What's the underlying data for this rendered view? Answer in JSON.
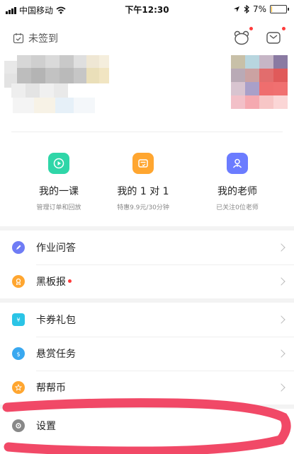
{
  "status_bar": {
    "carrier": "中国移动",
    "time": "下午12:30",
    "battery": "7%",
    "battery_level": 0.07
  },
  "header": {
    "checkin_label": "未签到",
    "icons": [
      "bear-icon",
      "mail-icon"
    ]
  },
  "quick_actions": [
    {
      "title": "我的一课",
      "sub": "管理订单和回放",
      "icon": "play-icon",
      "color": "#2fd6a8"
    },
    {
      "title": "我的 1 对 1",
      "sub": "特惠9.9元/30分钟",
      "icon": "card-check-icon",
      "color": "#ffa630"
    },
    {
      "title": "我的老师",
      "sub": "已关注0位老师",
      "icon": "teacher-icon",
      "color": "#6b7cff"
    }
  ],
  "menu": [
    {
      "label": "作业问答",
      "icon": "pen-icon",
      "color": "#6f7cf5"
    },
    {
      "label": "黑板报",
      "icon": "award-icon",
      "color": "#ffa630"
    },
    {
      "label": "卡券礼包",
      "icon": "coupon-icon",
      "color": "#2bc4e6"
    },
    {
      "label": "悬赏任务",
      "icon": "money-bag-icon",
      "color": "#39a8f0"
    },
    {
      "label": "帮帮币",
      "icon": "star-coin-icon",
      "color": "#ffa630"
    },
    {
      "label": "设置",
      "icon": "gear-icon",
      "color": "#888888"
    }
  ]
}
